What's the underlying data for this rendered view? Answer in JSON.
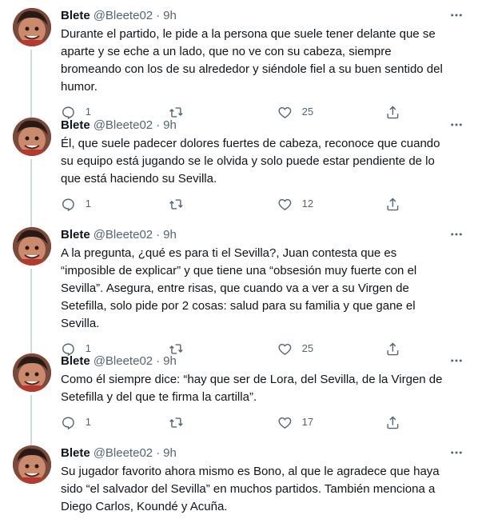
{
  "tweets": [
    {
      "name": "Blete",
      "handle": "@Bleete02",
      "separator": "·",
      "time": "9h",
      "text": "Durante el partido, le pide a la persona que suele tener delante que se aparte y se eche a un lado, que no ve con su cabeza, siempre bromeando con los de su alrededor y siéndole fiel a su buen sentido del humor.",
      "replies": "1",
      "retweets": "",
      "likes": "25"
    },
    {
      "name": "Blete",
      "handle": "@Bleete02",
      "separator": "·",
      "time": "9h",
      "text": "Él, que suele padecer dolores fuertes de cabeza, reconoce que cuando su equipo está jugando se le olvida y solo puede estar pendiente de lo que está haciendo su Sevilla.",
      "replies": "1",
      "retweets": "",
      "likes": "12"
    },
    {
      "name": "Blete",
      "handle": "@Bleete02",
      "separator": "·",
      "time": "9h",
      "text": "A la pregunta, ¿qué es para ti el Sevilla?, Juan contesta que es “imposible de explicar” y que tiene una “obsesión muy fuerte con el Sevilla”. Asegura, entre risas, que cuando va a ver a su Virgen de Setefilla, solo pide por 2 cosas: salud para su familia y que gane el Sevilla.",
      "replies": "1",
      "retweets": "",
      "likes": "25"
    },
    {
      "name": "Blete",
      "handle": "@Bleete02",
      "separator": "·",
      "time": "9h",
      "text": "Como él siempre dice: “hay que ser de Lora, del Sevilla, de la Virgen de Setefilla y del que te firma la cartilla”.",
      "replies": "1",
      "retweets": "",
      "likes": "17"
    },
    {
      "name": "Blete",
      "handle": "@Bleete02",
      "separator": "·",
      "time": "9h",
      "text": "Su jugador favorito ahora mismo es Bono, al que le agradece que haya sido “el salvador del Sevilla” en muchos partidos. También menciona a Diego Carlos, Koundé y Acuña.",
      "replies": "",
      "retweets": "",
      "likes": ""
    }
  ],
  "icons": {
    "reply": "reply-icon",
    "retweet": "retweet-icon",
    "like": "like-icon",
    "share": "share-icon",
    "more": "more-icon"
  },
  "colors": {
    "text": "#0f1419",
    "secondary": "#536471",
    "thread_line": "#cfd9de"
  }
}
